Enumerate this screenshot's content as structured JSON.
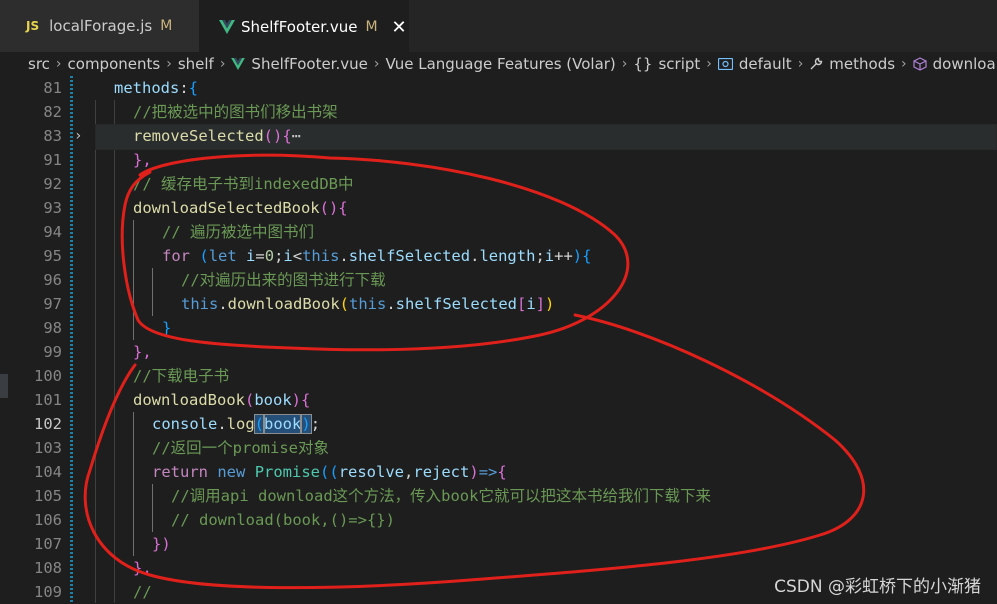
{
  "tabs": [
    {
      "icon": "JS",
      "label": "localForage.js",
      "status": "M"
    },
    {
      "icon": "vue-icon",
      "label": "ShelfFooter.vue",
      "status": "M",
      "close": "✕"
    }
  ],
  "breadcrumb": {
    "items": [
      "src",
      "components",
      "shelf",
      "ShelfFooter.vue",
      "Vue Language Features (Volar)",
      "script",
      "default",
      "methods",
      "downloa"
    ],
    "script_icon": "{}"
  },
  "lines": {
    "n81": "81",
    "n82": "82",
    "n83": "83",
    "n91": "91",
    "n92": "92",
    "n93": "93",
    "n94": "94",
    "n95": "95",
    "n96": "96",
    "n97": "97",
    "n98": "98",
    "n99": "99",
    "n100": "100",
    "n101": "101",
    "n102": "102",
    "n103": "103",
    "n104": "104",
    "n105": "105",
    "n106": "106",
    "n107": "107",
    "n108": "108",
    "n109": "109"
  },
  "code": {
    "l81_a": "methods",
    "l81_b": ":",
    "l81_c": "{",
    "l82": "//把被选中的图书们移出书架",
    "l83_a": "removeSelected",
    "l83_b": "(){",
    "l83_c": "⋯",
    "l91": "},",
    "l92": "// 缓存电子书到indexedDB中",
    "l93_a": "downloadSelectedBook",
    "l93_b": "(){",
    "l94": "// 遍历被选中图书们",
    "l95_for": "for",
    "l95_open": "(",
    "l95_let": "let",
    "l95_i": "i",
    "l95_eq": "=",
    "l95_zero": "0",
    "l95_semi": ";",
    "l95_i2": "i",
    "l95_lt": "<",
    "l95_this": "this",
    "l95_dot": ".",
    "l95_sel": "shelfSelected",
    "l95_dot2": ".",
    "l95_len": "length",
    "l95_semi2": ";",
    "l95_i3": "i",
    "l95_pp": "++",
    "l95_close": ")",
    "l95_brace": "{",
    "l96": "//对遍历出来的图书进行下载",
    "l97_this": "this",
    "l97_dot": ".",
    "l97_fn": "downloadBook",
    "l97_open": "(",
    "l97_this2": "this",
    "l97_dot2": ".",
    "l97_sel": "shelfSelected",
    "l97_br": "[",
    "l97_i": "i",
    "l97_brc": "]",
    "l97_close": ")",
    "l98": "}",
    "l99": "},",
    "l100": "//下载电子书",
    "l101_fn": "downloadBook",
    "l101_open": "(",
    "l101_arg": "book",
    "l101_close": "){",
    "l102_obj": "console",
    "l102_dot": ".",
    "l102_fn": "log",
    "l102_open": "(",
    "l102_arg": "book",
    "l102_close": ")",
    "l102_semi": ";",
    "l103": "//返回一个promise对象",
    "l104_ret": "return",
    "l104_new": "new",
    "l104_cls": "Promise",
    "l104_open": "((",
    "l104_a1": "resolve",
    "l104_comma": ",",
    "l104_a2": "reject",
    "l104_close": ")",
    "l104_arrow": "=>",
    "l104_brace": "{",
    "l105": "//调用api download这个方法，传入book它就可以把这本书给我们下载下来",
    "l106": "// download(book,()=>{})",
    "l107": "})",
    "l108": "},",
    "l109": "//"
  },
  "watermark": "CSDN @彩虹桥下的小渐猪",
  "colors": {
    "annotation": "#e0201a",
    "accent": "#007acc"
  }
}
